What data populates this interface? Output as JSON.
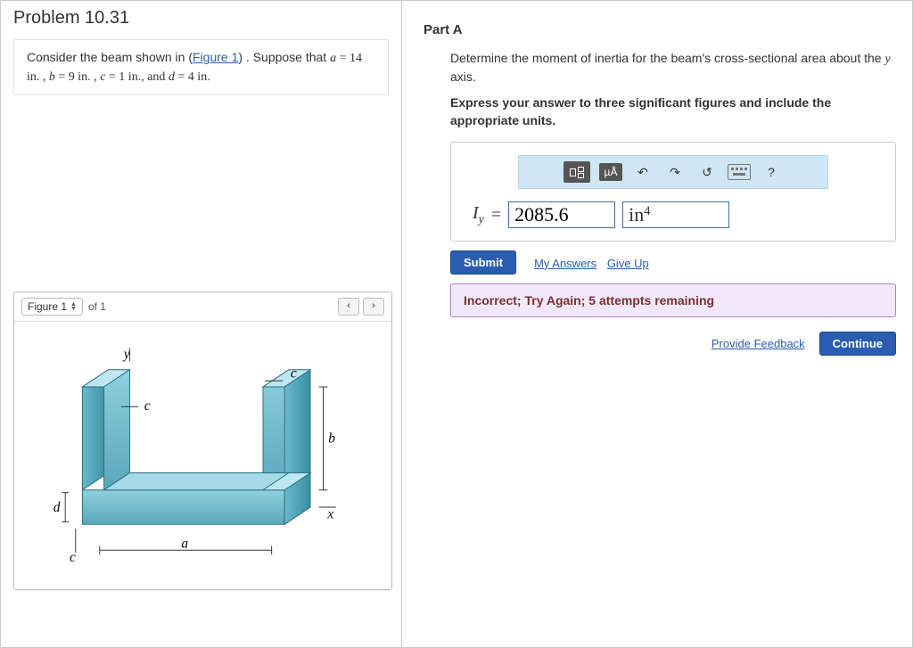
{
  "problem": {
    "title": "Problem 10.31",
    "intro_before_link": "Consider the beam shown in (",
    "figure_link": "Figure 1",
    "intro_after_link": ") . Suppose that ",
    "var_a": "a",
    "val_a": " = 14  in. , ",
    "var_b": "b",
    "val_b": " = 9  in. , ",
    "var_c": "c",
    "val_c": " = 1 in., and ",
    "var_d": "d",
    "val_d": " = 4  in."
  },
  "figure": {
    "label": "Figure 1",
    "of_text": "of 1",
    "prev": "‹",
    "next": "›",
    "axis_y": "y",
    "axis_x": "x",
    "dim_a": "a",
    "dim_b": "b",
    "dim_c": "c",
    "dim_d": "d"
  },
  "partA": {
    "title": "Part A",
    "question_pre": "Determine the moment of inertia for the beam's cross-sectional area about the ",
    "question_var": "y",
    "question_post": " axis.",
    "instruction": "Express your answer to three significant figures and include the appropriate units.",
    "units_btn": "µÅ",
    "help_btn": "?",
    "lhs_var": "I",
    "lhs_sub": "y",
    "eq": " = ",
    "value": "2085.6",
    "unit_base": "in",
    "unit_exp": "4",
    "submit": "Submit",
    "my_answers": "My Answers",
    "give_up": "Give Up",
    "feedback": "Incorrect; Try Again; 5 attempts remaining",
    "provide_feedback": "Provide Feedback",
    "continue": "Continue"
  }
}
